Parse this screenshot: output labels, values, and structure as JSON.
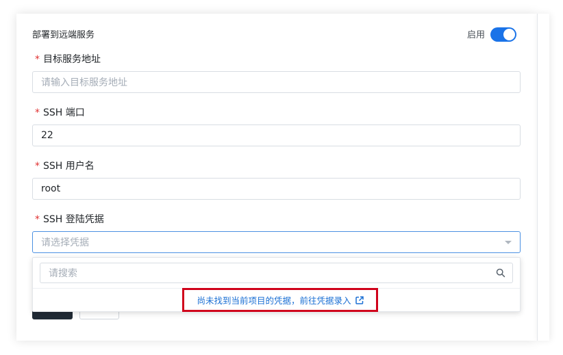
{
  "section": {
    "title": "部署到远端服务",
    "toggle_label": "启用",
    "toggle_on": true
  },
  "fields": {
    "target": {
      "label": "目标服务地址",
      "placeholder": "请输入目标服务地址",
      "value": ""
    },
    "port": {
      "label": "SSH 端口",
      "value": "22"
    },
    "user": {
      "label": "SSH 用户名",
      "value": "root"
    },
    "credential": {
      "label": "SSH 登陆凭据",
      "placeholder": "请选择凭据"
    }
  },
  "required_mark": "*",
  "dropdown": {
    "search_placeholder": "请搜索",
    "empty_link": "尚未找到当前项目的凭据，前往凭据录入"
  },
  "colors": {
    "accent": "#1a73e8",
    "highlight": "#d0021b",
    "link": "#1a6fd4"
  }
}
